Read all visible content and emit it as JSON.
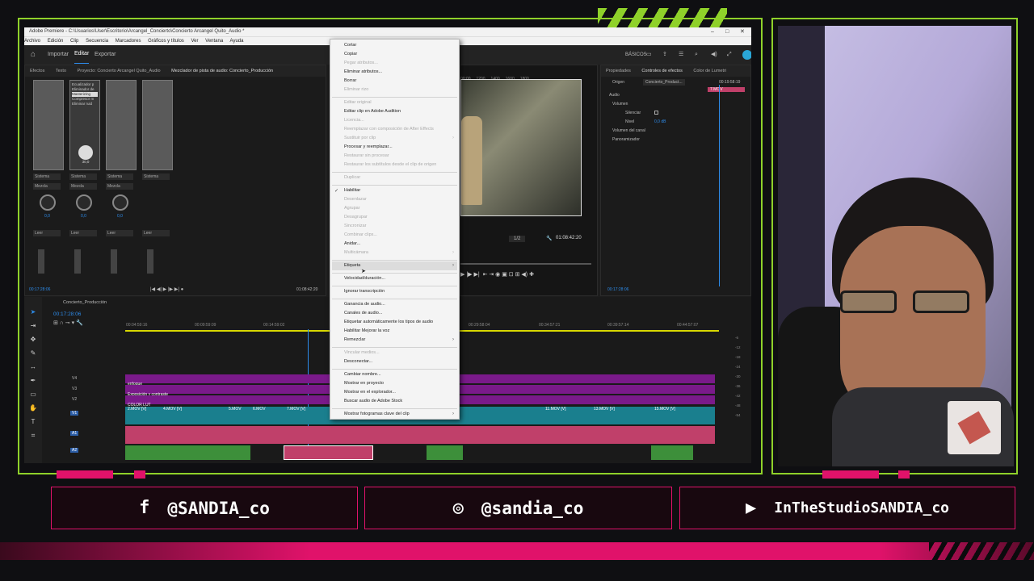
{
  "window": {
    "title": "Adobe Premiere - C:\\Usuarios\\User\\Escritorio\\Arcangel_Concierto\\Concierto Arcangel Quito_Audio *",
    "menu": [
      "Archivo",
      "Edición",
      "Clip",
      "Secuencia",
      "Marcadores",
      "Gráficos y títulos",
      "Ver",
      "Ventana",
      "Ayuda"
    ]
  },
  "appbar": {
    "home_icon": "home-icon",
    "tabs": [
      "Importar",
      "Editar",
      "Exportar"
    ],
    "workspace": "BÁSICOS"
  },
  "left_panel": {
    "tabs": [
      "Efectos",
      "Texto",
      "Proyecto: Concierto Arcangel Quito_Audio",
      "Mezclador de pista de audio: Concierto_Producción"
    ],
    "effects_list": [
      "Ecualizador p",
      "Eliminador de",
      "Masterizing",
      "Compresor m",
      "Eliminar ruid"
    ],
    "fx_value": "30,0",
    "fx_unit": "Hz",
    "fx_label": "ec. de banda 65",
    "channel_selects": [
      "Sistema",
      "Sistema",
      "Sistema",
      "Sistema"
    ],
    "mix_selects": [
      "Mezcla",
      "Mezcla",
      "Mezcla"
    ],
    "knob_values": [
      "0,0",
      "0,0",
      "0,0"
    ],
    "read_selects": [
      "Leer",
      "Leer",
      "Leer",
      "Leer"
    ],
    "timecode": "00:17:28:06",
    "end_timecode": "01:08:42:20"
  },
  "program": {
    "ruler": [
      "00:00",
      "1200",
      "1400",
      "1600",
      "1800"
    ],
    "zoom": "1/2",
    "timecode": "01:08:42:20"
  },
  "effect_controls": {
    "tabs": [
      "Propiedades",
      "Controles de efectos",
      "Color de Lumetri"
    ],
    "source": "Origen",
    "sequence": "Concierto_Product...",
    "time": "00:19:58:19",
    "clip": "7.MOV",
    "section": "Audio",
    "rows": [
      "Volumen",
      "Silenciar",
      "Nivel",
      "Volumen del canal",
      "Panoramizador"
    ],
    "level_value": "0,0 dB",
    "timecode": "00:17:28:06"
  },
  "timeline": {
    "sequence": "Concierto_Producción",
    "timecode": "00:17:28:06",
    "ruler": [
      "00:04:59:16",
      "00:09:59:09",
      "00:14:59:02",
      "00:29:58:04",
      "00:34:57:21",
      "00:39:57:14",
      "00:44:57:07"
    ],
    "tracks_v": [
      "V4",
      "V3",
      "V2",
      "V1"
    ],
    "tracks_a": [
      "A1",
      "A2",
      "A3"
    ],
    "track_labels": [
      "enfoque",
      "Exposición y contraste",
      "COLOR LUT"
    ],
    "video_clips": [
      "2.MOV [V]",
      "4.MOV [V]",
      "5.MOV",
      "6.MOV",
      "7.MOV [V]",
      "11.MOV [V]",
      "13.MOV [V]",
      "15.MOV [V]"
    ],
    "meter": [
      "-6",
      "-12",
      "-18",
      "-24",
      "-30",
      "-36",
      "-42",
      "-48",
      "-54"
    ]
  },
  "context_menu": {
    "items": [
      {
        "label": "Cortar",
        "disabled": false
      },
      {
        "label": "Copiar",
        "disabled": false
      },
      {
        "label": "Pegar atributos...",
        "disabled": true
      },
      {
        "label": "Eliminar atributos...",
        "disabled": false
      },
      {
        "label": "Borrar",
        "disabled": false
      },
      {
        "label": "Eliminar rizo",
        "disabled": true
      },
      {
        "label": "Editar original",
        "disabled": true
      },
      {
        "label": "Editar clip en Adobe Audition",
        "disabled": false
      },
      {
        "label": "Licencia...",
        "disabled": true
      },
      {
        "label": "Reemplazar con composición de After Effects",
        "disabled": true
      },
      {
        "label": "Sustituir por clip",
        "disabled": true
      },
      {
        "label": "Procesar y reemplazar...",
        "disabled": false
      },
      {
        "label": "Restaurar sin procesar",
        "disabled": true
      },
      {
        "label": "Restaurar los subtítulos desde el clip de origen",
        "disabled": true
      },
      {
        "label": "Duplicar",
        "disabled": true
      },
      {
        "label": "Habilitar",
        "disabled": false
      },
      {
        "label": "Desenlazar",
        "disabled": true
      },
      {
        "label": "Agrupar",
        "disabled": true
      },
      {
        "label": "Desagrupar",
        "disabled": true
      },
      {
        "label": "Sincronizar",
        "disabled": true
      },
      {
        "label": "Combinar clips...",
        "disabled": true
      },
      {
        "label": "Anidar...",
        "disabled": false
      },
      {
        "label": "Multicámara",
        "disabled": true
      },
      {
        "label": "Etiqueta",
        "disabled": false
      },
      {
        "label": "Velocidad/duración...",
        "disabled": false
      },
      {
        "label": "Ignorar transcripción",
        "disabled": false
      },
      {
        "label": "Ganancia de audio...",
        "disabled": false
      },
      {
        "label": "Canales de audio...",
        "disabled": false
      },
      {
        "label": "Etiquetar automáticamente los tipos de audio",
        "disabled": false
      },
      {
        "label": "Habilitar Mejorar la voz",
        "disabled": false
      },
      {
        "label": "Remezclar",
        "disabled": false
      },
      {
        "label": "Vincular medios...",
        "disabled": true
      },
      {
        "label": "Desconectar...",
        "disabled": false
      },
      {
        "label": "Cambiar nombre...",
        "disabled": false
      },
      {
        "label": "Mostrar en proyecto",
        "disabled": false
      },
      {
        "label": "Mostrar en el explorador...",
        "disabled": false
      },
      {
        "label": "Buscar audio de Adobe Stock",
        "disabled": false
      },
      {
        "label": "Mostrar fotogramas clave del clip",
        "disabled": false
      }
    ]
  },
  "social": {
    "facebook": "@SANDIA_co",
    "instagram": "@sandia_co",
    "youtube": "InTheStudioSANDIA_co"
  },
  "colors": {
    "accent_green": "#8fd12a",
    "accent_pink": "#e0126a",
    "premiere_blue": "#2d8ceb"
  }
}
